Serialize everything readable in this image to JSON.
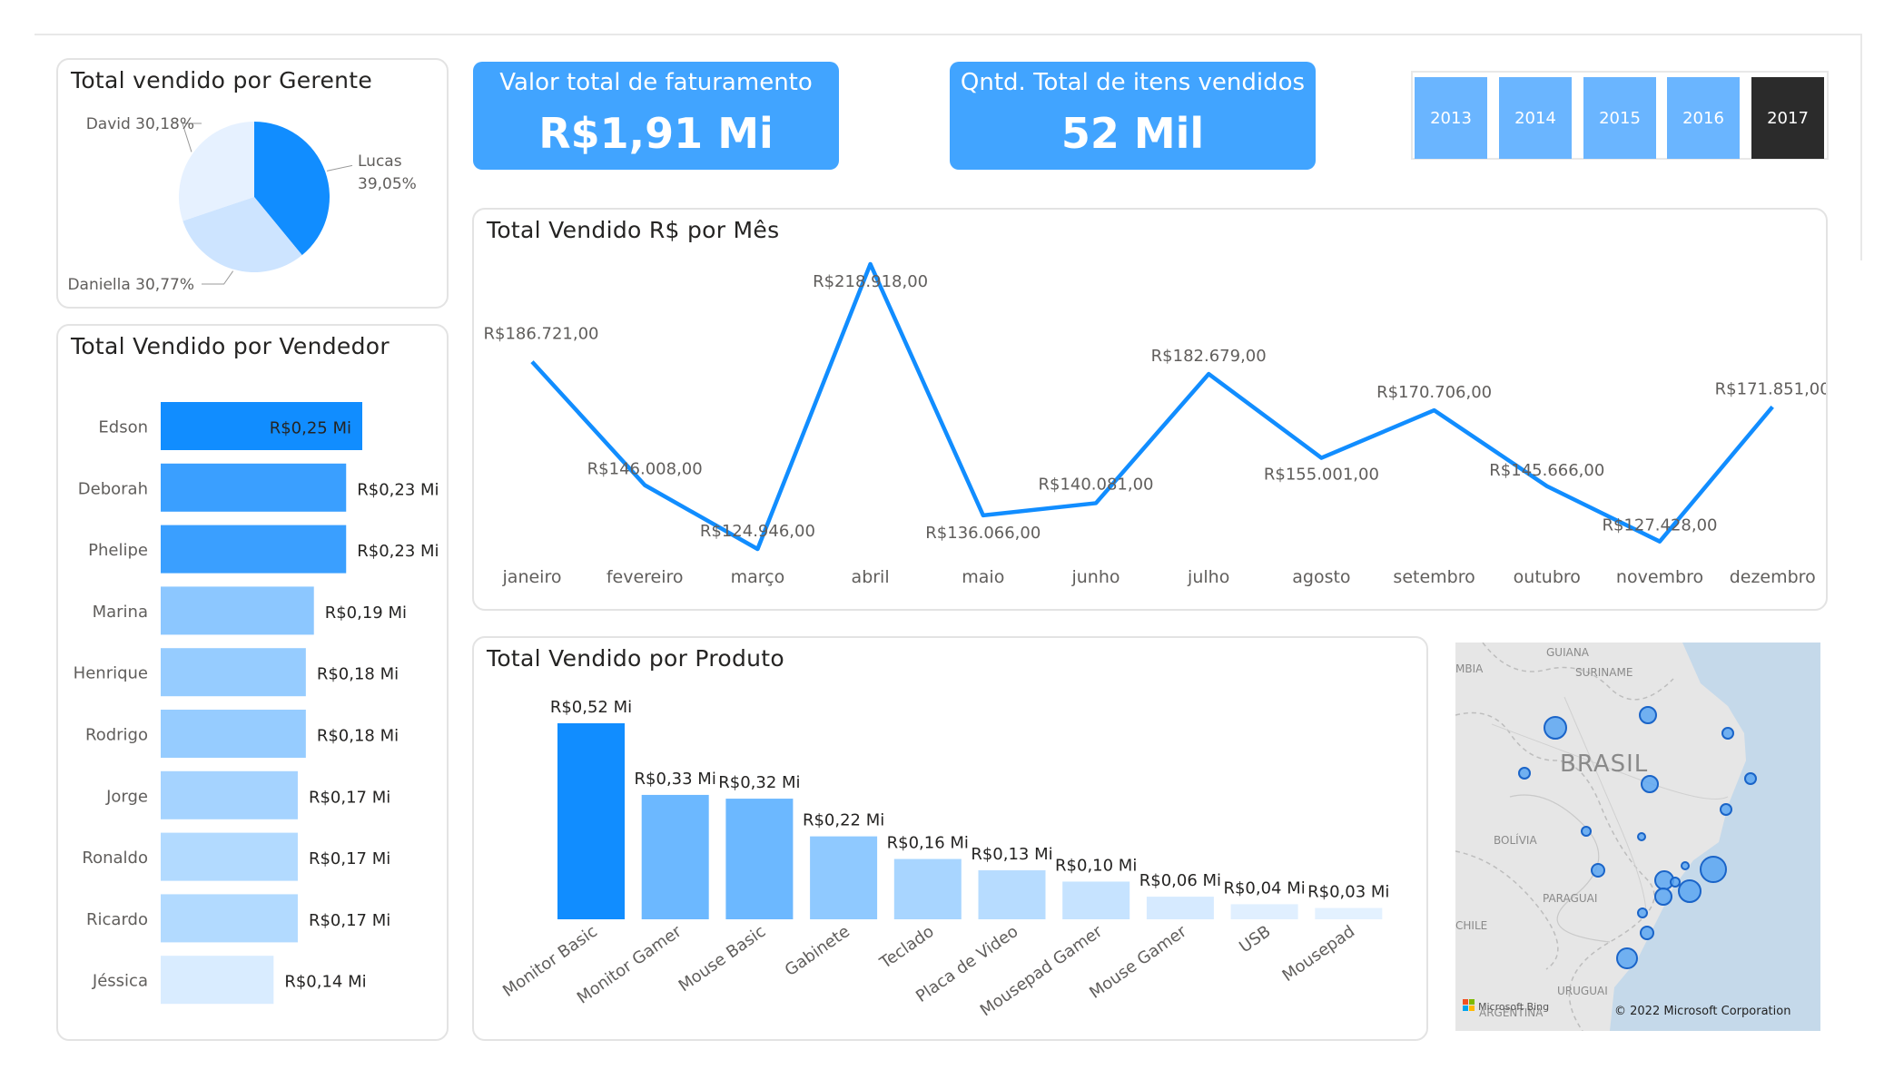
{
  "managers": {
    "title": "Total vendido por Gerente",
    "chart_data": {
      "type": "pie",
      "labels": [
        "Lucas",
        "Daniella",
        "David"
      ],
      "values": [
        39.05,
        30.77,
        30.18
      ],
      "data_labels": [
        "Lucas 39,05%",
        "Daniella 30,77%",
        "David 30,18%"
      ],
      "colors": [
        "#118dff",
        "#cde4ff",
        "#e6f1ff"
      ]
    }
  },
  "kpis": [
    {
      "label": "Valor total de faturamento",
      "value": "R$1,91 Mi"
    },
    {
      "label": "Qntd. Total de itens vendidos",
      "value": "52 Mil"
    }
  ],
  "year_slicer": {
    "options": [
      "2013",
      "2014",
      "2015",
      "2016",
      "2017"
    ],
    "selected": "2017",
    "colors": {
      "default": "#6ab5ff",
      "selected": "#2b2b2b"
    }
  },
  "sellers": {
    "title": "Total Vendido por Vendedor",
    "chart_data": {
      "type": "bar",
      "orientation": "horizontal",
      "categories": [
        "Edson",
        "Deborah",
        "Phelipe",
        "Marina",
        "Henrique",
        "Rodrigo",
        "Jorge",
        "Ronaldo",
        "Ricardo",
        "Jéssica"
      ],
      "values": [
        0.25,
        0.23,
        0.23,
        0.19,
        0.18,
        0.18,
        0.17,
        0.17,
        0.17,
        0.14
      ],
      "data_labels": [
        "R$0,25 Mi",
        "R$0,23 Mi",
        "R$0,23 Mi",
        "R$0,19 Mi",
        "R$0,18 Mi",
        "R$0,18 Mi",
        "R$0,17 Mi",
        "R$0,17 Mi",
        "R$0,17 Mi",
        "R$0,14 Mi"
      ],
      "colors": [
        "#118dff",
        "#3a9fff",
        "#3a9fff",
        "#8cc7ff",
        "#96ccff",
        "#96ccff",
        "#a5d3ff",
        "#b2daff",
        "#b2daff",
        "#d9ecff"
      ]
    }
  },
  "monthly": {
    "title": "Total Vendido R$ por Mês",
    "chart_data": {
      "type": "line",
      "categories": [
        "janeiro",
        "fevereiro",
        "março",
        "abril",
        "maio",
        "junho",
        "julho",
        "agosto",
        "setembro",
        "outubro",
        "novembro",
        "dezembro"
      ],
      "values": [
        186721,
        146008,
        124946,
        218918,
        136066,
        140081,
        182679,
        155001,
        170706,
        145666,
        127428,
        171851
      ],
      "data_labels": [
        "R$186.721,00",
        "R$146.008,00",
        "R$124.946,00",
        "R$218.918,00",
        "R$136.066,00",
        "R$140.081,00",
        "R$182.679,00",
        "R$155.001,00",
        "R$170.706,00",
        "R$145.666,00",
        "R$127.428,00",
        "R$171.851,00"
      ],
      "color": "#118dff"
    }
  },
  "products": {
    "title": "Total Vendido por Produto",
    "chart_data": {
      "type": "bar",
      "categories": [
        "Monitor Basic",
        "Monitor Gamer",
        "Mouse Basic",
        "Gabinete",
        "Teclado",
        "Placa de Video",
        "Mousepad Gamer",
        "Mouse Gamer",
        "USB",
        "Mousepad"
      ],
      "values": [
        0.52,
        0.33,
        0.32,
        0.22,
        0.16,
        0.13,
        0.1,
        0.06,
        0.04,
        0.03
      ],
      "data_labels": [
        "R$0,52 Mi",
        "R$0,33 Mi",
        "R$0,32 Mi",
        "R$0,22 Mi",
        "R$0,16 Mi",
        "R$0,13 Mi",
        "R$0,10 Mi",
        "R$0,06 Mi",
        "R$0,04 Mi",
        "R$0,03 Mi"
      ],
      "colors": [
        "#118dff",
        "#6cb8ff",
        "#6cb8ff",
        "#8fc9ff",
        "#a8d5ff",
        "#b7dcff",
        "#c6e3ff",
        "#d6eaff",
        "#e0efff",
        "#e3f1ff"
      ]
    }
  },
  "map": {
    "labels": [
      "GUIANA",
      "SURINAME",
      "MBIA",
      "BRASIL",
      "BOLÍVIA",
      "PARAGUAI",
      "CHILE",
      "URUGUAI",
      "ARGENTINA"
    ],
    "attribution": "© 2022 Microsoft Corporation",
    "provider": "Microsoft Bing",
    "bubble_color": "#5aa6f2"
  }
}
